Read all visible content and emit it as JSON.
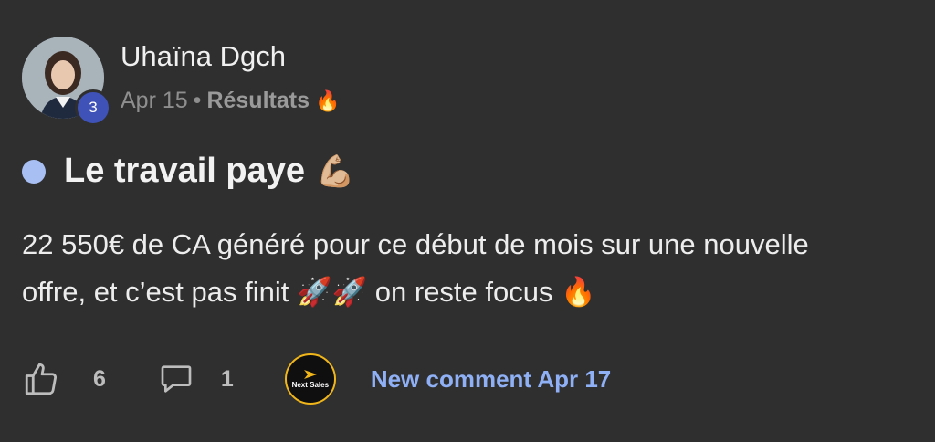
{
  "post": {
    "author_name": "Uhaïna Dgch",
    "author_level": "3",
    "date": "Apr 15",
    "separator": "•",
    "category": "Résultats",
    "category_emoji": "🔥",
    "title": "Le travail paye",
    "title_emoji": "💪🏼",
    "body": "22 550€ de CA généré pour ce début de mois sur une nouvelle offre, et c’est pas finit 🚀🚀 on reste focus 🔥"
  },
  "footer": {
    "like_count": "6",
    "comment_count": "1",
    "brand_logo_text": "Next Sales",
    "new_comment_label": "New comment Apr 17"
  },
  "colors": {
    "background": "#2f2f2f",
    "unread_dot": "#a8bff4",
    "level_badge": "#3f52b7",
    "link": "#8fb0f5"
  },
  "icons": [
    "thumbs-up-icon",
    "comment-icon",
    "fire-icon",
    "rocket-icon",
    "flexed-bicep-icon"
  ]
}
